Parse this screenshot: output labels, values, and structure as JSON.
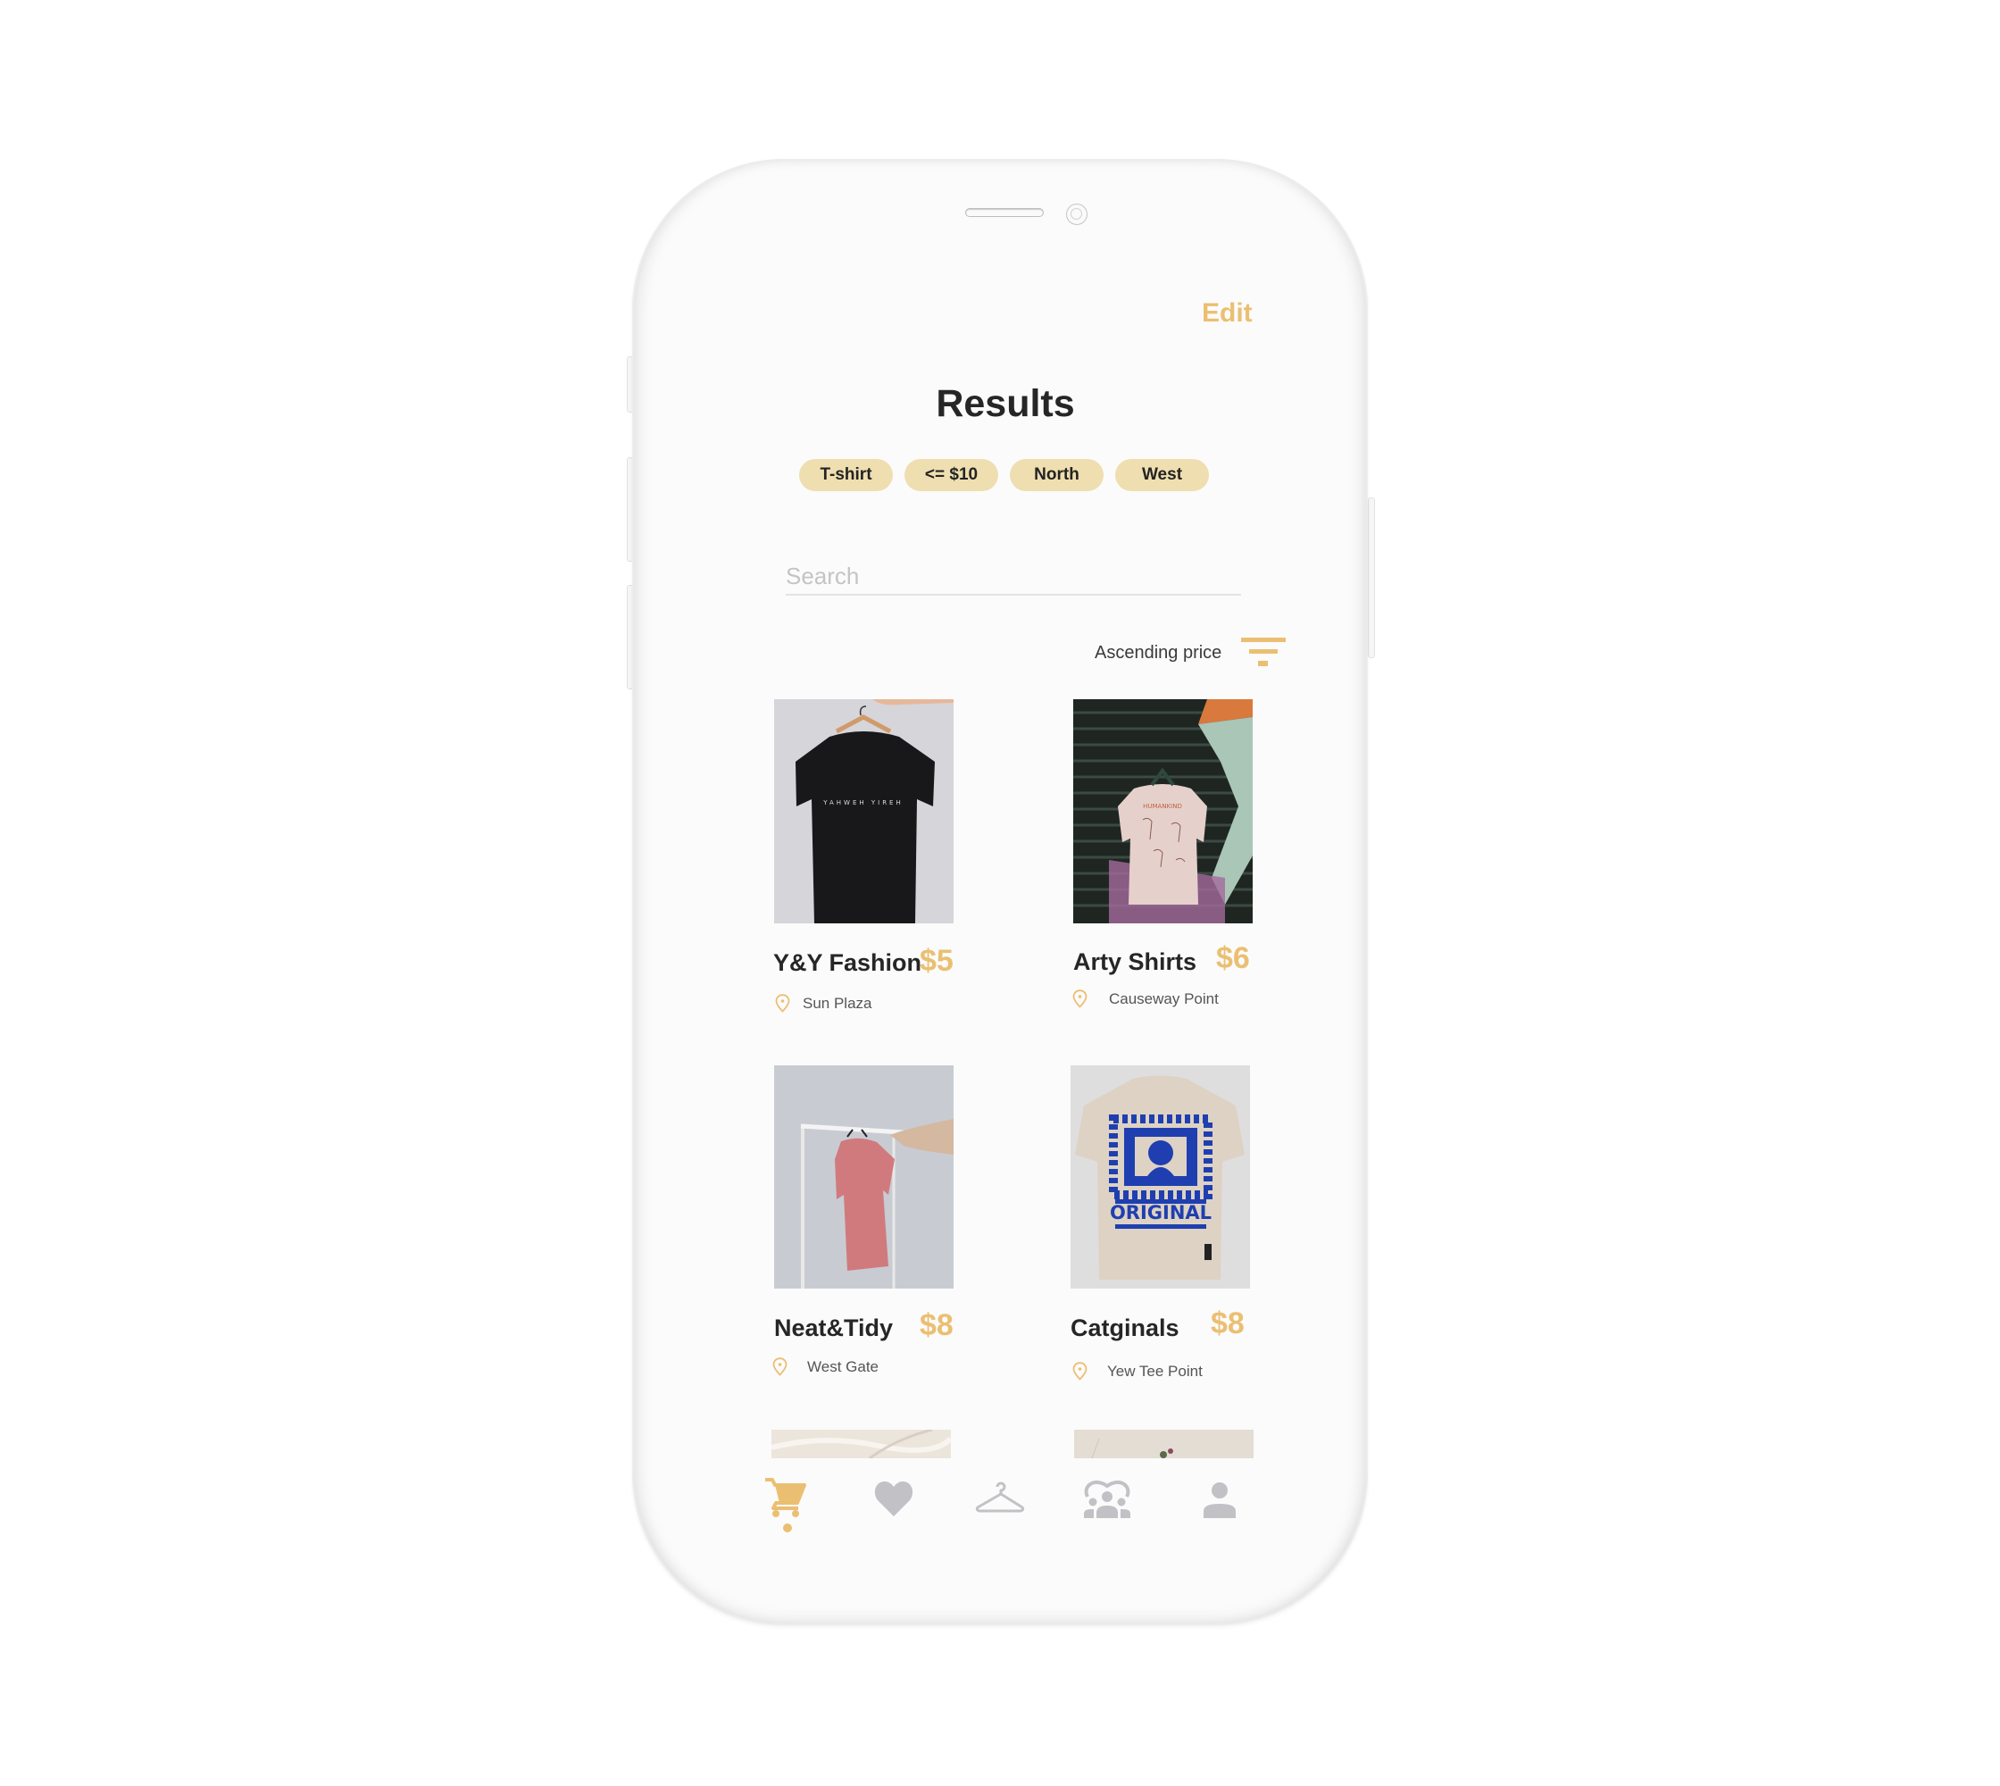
{
  "header": {
    "edit_label": "Edit",
    "title": "Results"
  },
  "filters": [
    "T-shirt",
    "<= $10",
    "North",
    "West"
  ],
  "search": {
    "placeholder": "Search",
    "value": ""
  },
  "sort": {
    "label": "Ascending price",
    "icon": "filter-sort-icon"
  },
  "colors": {
    "accent": "#EBBF72",
    "chip_bg": "#EFDEAF",
    "text_dark": "#262626",
    "icon_inactive": "#C2C1C6"
  },
  "products": [
    {
      "name": "Y&Y Fashion",
      "price": "$5",
      "location": "Sun Plaza",
      "image": "black t-shirt on wooden hanger"
    },
    {
      "name": "Arty Shirts",
      "price": "$6",
      "location": "Causeway Point",
      "image": "pink art-print t-shirt on shutter"
    },
    {
      "name": "Neat&Tidy",
      "price": "$8",
      "location": "West Gate",
      "image": "pink t-shirt on clothes rack"
    },
    {
      "name": "Catginals",
      "price": "$8",
      "location": "Yew Tee Point",
      "image": "beige t-shirt with blue ORIGINAL cat print"
    }
  ],
  "nav": {
    "items": [
      {
        "icon": "cart-icon",
        "active": true
      },
      {
        "icon": "heart-icon",
        "active": false
      },
      {
        "icon": "hanger-icon",
        "active": false
      },
      {
        "icon": "community-icon",
        "active": false
      },
      {
        "icon": "profile-icon",
        "active": false
      }
    ]
  }
}
